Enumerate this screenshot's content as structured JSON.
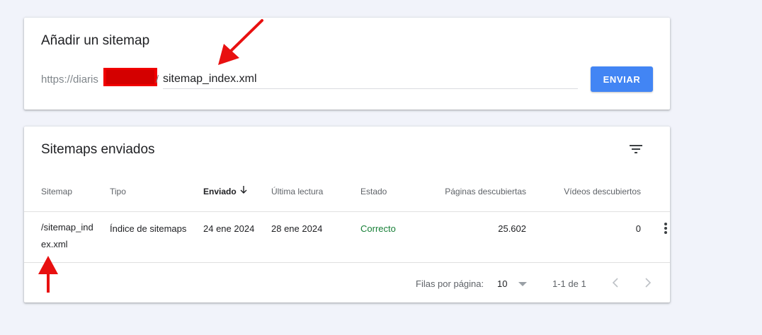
{
  "add_sitemap": {
    "title": "Añadir un sitemap",
    "url_prefix": "https://diaris",
    "slash": "/",
    "input_value": "sitemap_index.xml",
    "submit_label": "ENVIAR"
  },
  "submitted": {
    "title": "Sitemaps enviados",
    "filter_icon": "filter-icon",
    "columns": [
      "Sitemap",
      "Tipo",
      "Enviado",
      "Última lectura",
      "Estado",
      "Páginas descubiertas",
      "Vídeos descubiertos"
    ],
    "sort_icon": "arrow-down-icon",
    "rows": [
      {
        "sitemap": "/sitemap_index.xml",
        "type": "Índice de sitemaps",
        "submitted": "24 ene 2024",
        "last_read": "28 ene 2024",
        "status": "Correcto",
        "pages": "25.602",
        "videos": "0"
      }
    ],
    "pagination": {
      "rows_label": "Filas por página:",
      "rows_value": "10",
      "range": "1-1 de 1"
    }
  },
  "colors": {
    "accent": "#4285f4",
    "status_ok": "#188038",
    "annotation": "#e81010"
  }
}
